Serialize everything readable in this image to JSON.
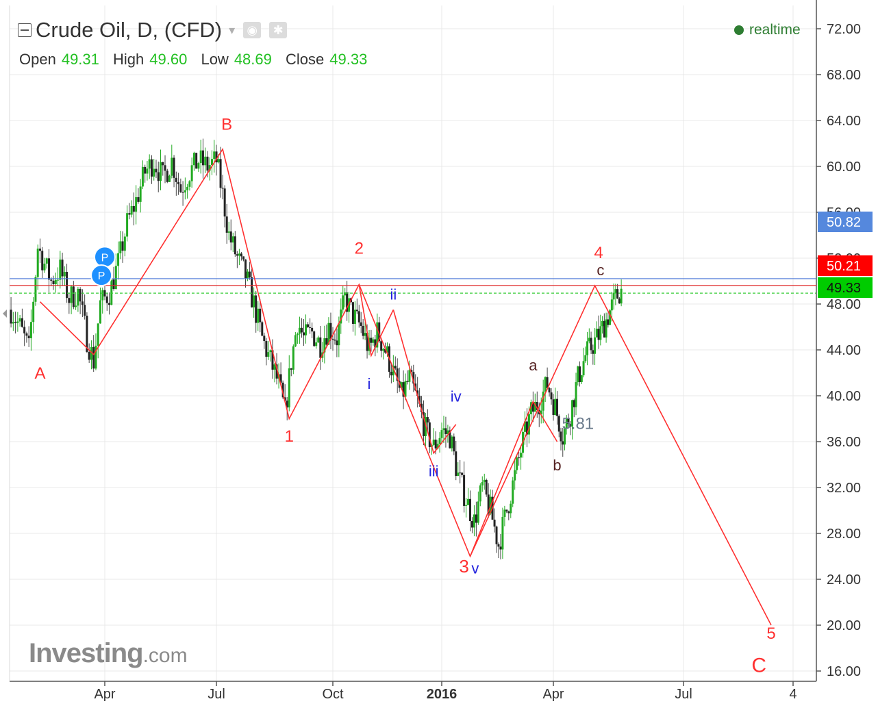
{
  "header": {
    "title": "Crude Oil, D, (CFD)",
    "ohlc": [
      {
        "key": "Open",
        "value": "49.31"
      },
      {
        "key": "High",
        "value": "49.60"
      },
      {
        "key": "Low",
        "value": "48.69"
      },
      {
        "key": "Close",
        "value": "49.33"
      }
    ],
    "status": "realtime"
  },
  "logo": {
    "main": "Investing",
    "suffix": ".com"
  },
  "colors": {
    "up": "#22aa22",
    "down": "#444444",
    "wave": "#ff3030",
    "blue_label": "#2222dd",
    "brown_label": "#552222",
    "grid": "#e8e8e8",
    "blue_line": "#4a78d8",
    "red_line": "#e03030",
    "green_line": "#33cc33",
    "tag_blue": "#5588dd",
    "tag_red": "#ff0000",
    "tag_green": "#00cc00",
    "pin": "#1e90ff"
  },
  "chart_data": {
    "type": "candlestick",
    "y_axis": {
      "ticks": [
        "72.00",
        "68.00",
        "64.00",
        "60.00",
        "56.00",
        "52.00",
        "48.00",
        "44.00",
        "40.00",
        "36.00",
        "32.00",
        "28.00",
        "24.00",
        "20.00",
        "16.00"
      ],
      "range": [
        15,
        73.5
      ]
    },
    "x_axis": {
      "ticks": [
        "Apr",
        "Jul",
        "Oct",
        "2016",
        "Apr",
        "Jul",
        "4"
      ]
    },
    "price_tags": [
      {
        "label": "50.82",
        "value": 50.82,
        "color": "tag_blue"
      },
      {
        "label": "50.21",
        "value": 50.21,
        "color": "tag_red"
      },
      {
        "label": "49.33",
        "value": 49.33,
        "color": "tag_green"
      }
    ],
    "horizontal_lines": [
      {
        "value": 50.21,
        "color": "blue_line",
        "style": "solid"
      },
      {
        "value": 49.6,
        "color": "red_line",
        "style": "solid"
      },
      {
        "value": 48.95,
        "color": "green_line",
        "style": "dashed"
      }
    ],
    "price_anchors": [
      {
        "t": 0,
        "p": 47.5
      },
      {
        "t": 4,
        "p": 46.0
      },
      {
        "t": 8,
        "p": 44.0
      },
      {
        "t": 12,
        "p": 53.0
      },
      {
        "t": 18,
        "p": 50.0
      },
      {
        "t": 22,
        "p": 51.0
      },
      {
        "t": 26,
        "p": 48.5
      },
      {
        "t": 30,
        "p": 49.0
      },
      {
        "t": 34,
        "p": 45.0
      },
      {
        "t": 37,
        "p": 43.0
      },
      {
        "t": 40,
        "p": 48.0
      },
      {
        "t": 44,
        "p": 49.0
      },
      {
        "t": 48,
        "p": 51.5
      },
      {
        "t": 52,
        "p": 55.0
      },
      {
        "t": 56,
        "p": 57.0
      },
      {
        "t": 60,
        "p": 59.5
      },
      {
        "t": 64,
        "p": 60.5
      },
      {
        "t": 68,
        "p": 59.0
      },
      {
        "t": 72,
        "p": 60.5
      },
      {
        "t": 76,
        "p": 58.0
      },
      {
        "t": 80,
        "p": 59.5
      },
      {
        "t": 84,
        "p": 60.5
      },
      {
        "t": 88,
        "p": 60.0
      },
      {
        "t": 92,
        "p": 60.5
      },
      {
        "t": 95,
        "p": 57.5
      },
      {
        "t": 98,
        "p": 54.0
      },
      {
        "t": 102,
        "p": 52.0
      },
      {
        "t": 106,
        "p": 50.5
      },
      {
        "t": 110,
        "p": 48.0
      },
      {
        "t": 114,
        "p": 45.0
      },
      {
        "t": 118,
        "p": 43.0
      },
      {
        "t": 122,
        "p": 41.0
      },
      {
        "t": 125,
        "p": 38.5
      },
      {
        "t": 128,
        "p": 43.0
      },
      {
        "t": 131,
        "p": 46.5
      },
      {
        "t": 134,
        "p": 45.0
      },
      {
        "t": 138,
        "p": 45.5
      },
      {
        "t": 142,
        "p": 44.5
      },
      {
        "t": 146,
        "p": 46.0
      },
      {
        "t": 150,
        "p": 45.0
      },
      {
        "t": 154,
        "p": 48.5
      },
      {
        "t": 158,
        "p": 47.0
      },
      {
        "t": 162,
        "p": 46.0
      },
      {
        "t": 166,
        "p": 44.0
      },
      {
        "t": 170,
        "p": 45.5
      },
      {
        "t": 174,
        "p": 44.0
      },
      {
        "t": 178,
        "p": 42.0
      },
      {
        "t": 182,
        "p": 40.0
      },
      {
        "t": 186,
        "p": 41.5
      },
      {
        "t": 190,
        "p": 39.5
      },
      {
        "t": 194,
        "p": 37.0
      },
      {
        "t": 198,
        "p": 35.5
      },
      {
        "t": 202,
        "p": 37.0
      },
      {
        "t": 206,
        "p": 36.5
      },
      {
        "t": 210,
        "p": 33.0
      },
      {
        "t": 214,
        "p": 31.0
      },
      {
        "t": 218,
        "p": 29.0
      },
      {
        "t": 222,
        "p": 32.0
      },
      {
        "t": 226,
        "p": 30.0
      },
      {
        "t": 230,
        "p": 27.0
      },
      {
        "t": 234,
        "p": 30.0
      },
      {
        "t": 238,
        "p": 33.0
      },
      {
        "t": 242,
        "p": 36.0
      },
      {
        "t": 246,
        "p": 38.5
      },
      {
        "t": 250,
        "p": 39.5
      },
      {
        "t": 254,
        "p": 41.0
      },
      {
        "t": 258,
        "p": 39.0
      },
      {
        "t": 262,
        "p": 36.5
      },
      {
        "t": 266,
        "p": 38.5
      },
      {
        "t": 270,
        "p": 41.5
      },
      {
        "t": 274,
        "p": 43.5
      },
      {
        "t": 278,
        "p": 44.5
      },
      {
        "t": 282,
        "p": 45.5
      },
      {
        "t": 286,
        "p": 47.0
      },
      {
        "t": 290,
        "p": 48.5
      },
      {
        "t": 293,
        "p": 49.33
      }
    ],
    "wave_lines": [
      {
        "name": "corrective-wave",
        "points": [
          [
            13,
            48.2
          ],
          [
            37,
            43.6
          ],
          [
            95,
            61.5
          ],
          [
            127,
            38.0
          ],
          [
            161,
            49.7
          ],
          [
            216,
            26.0
          ],
          [
            279,
            49.6
          ],
          [
            362,
            20.0
          ]
        ]
      },
      {
        "name": "sub-wave-i-ii",
        "points": [
          [
            161,
            49.7
          ],
          [
            167,
            43.5
          ],
          [
            178,
            47.5
          ]
        ]
      },
      {
        "name": "sub-wave-iii-iv",
        "points": [
          [
            178,
            47.5
          ],
          [
            198,
            35.0
          ],
          [
            209,
            37.5
          ]
        ]
      },
      {
        "name": "sub-wave-a-b",
        "points": [
          [
            216,
            26.0
          ],
          [
            247,
            39.5
          ],
          [
            259,
            36.0
          ]
        ]
      }
    ],
    "annotations": [
      {
        "text": "A",
        "t": 13,
        "p": 41.5,
        "color": "wave",
        "size": 24
      },
      {
        "text": "B",
        "t": 97,
        "p": 63.2,
        "color": "wave",
        "size": 24
      },
      {
        "text": "1",
        "t": 127,
        "p": 36.0,
        "color": "wave",
        "size": 24
      },
      {
        "text": "2",
        "t": 161,
        "p": 52.4,
        "color": "wave",
        "size": 24
      },
      {
        "text": "ii",
        "t": 178,
        "p": 48.4,
        "color": "blue_label",
        "size": 22
      },
      {
        "text": "i",
        "t": 166,
        "p": 40.6,
        "color": "blue_label",
        "size": 22
      },
      {
        "text": "iv",
        "t": 209,
        "p": 39.5,
        "color": "blue_label",
        "size": 22
      },
      {
        "text": "iii",
        "t": 198,
        "p": 33.0,
        "color": "blue_label",
        "size": 22
      },
      {
        "text": "3",
        "t": 213,
        "p": 24.6,
        "color": "wave",
        "size": 26
      },
      {
        "text": "v",
        "t": 218.5,
        "p": 24.5,
        "color": "blue_label",
        "size": 22
      },
      {
        "text": "a",
        "t": 247,
        "p": 42.2,
        "color": "brown_label",
        "size": 22
      },
      {
        "text": "b",
        "t": 259,
        "p": 33.5,
        "color": "brown_label",
        "size": 22
      },
      {
        "text": "5.81",
        "t": 270,
        "p": 37.1,
        "color": "#6b7b8c",
        "size": 24
      },
      {
        "text": "4",
        "t": 281,
        "p": 52.0,
        "color": "wave",
        "size": 24
      },
      {
        "text": "c",
        "t": 282,
        "p": 50.5,
        "color": "brown_label",
        "size": 22
      },
      {
        "text": "5",
        "t": 362,
        "p": 18.8,
        "color": "wave",
        "size": 24
      },
      {
        "text": "C",
        "t": 357,
        "p": 15.9,
        "color": "wave",
        "size": 30
      }
    ],
    "pins": [
      {
        "label": "P",
        "t": 42,
        "p": 52.1
      },
      {
        "label": "P",
        "t": 40.5,
        "p": 50.5
      }
    ]
  }
}
